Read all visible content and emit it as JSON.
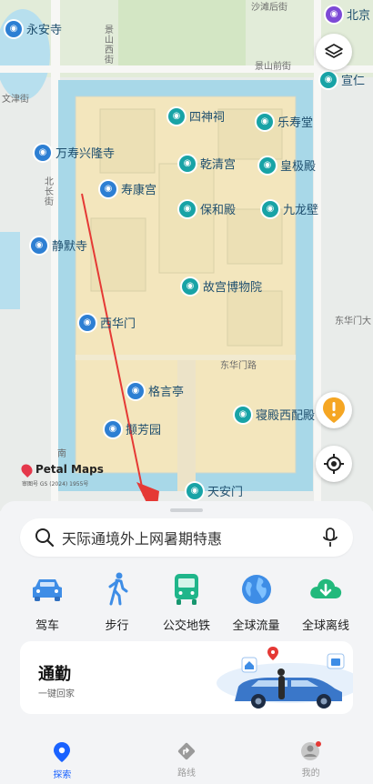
{
  "map": {
    "pois": [
      {
        "id": "yongansi",
        "label": "永安寺",
        "kind": "blue"
      },
      {
        "id": "beijing",
        "label": "北京"
      },
      {
        "id": "xuanren",
        "label": "宣仁"
      },
      {
        "id": "sishenci",
        "label": "四神祠"
      },
      {
        "id": "leshoutang",
        "label": "乐寿堂"
      },
      {
        "id": "wanshou",
        "label": "万寿兴隆寺",
        "kind": "blue"
      },
      {
        "id": "qianqinggong",
        "label": "乾清宫"
      },
      {
        "id": "huangjidian",
        "label": "皇极殿"
      },
      {
        "id": "shoukanggong",
        "label": "寿康宫"
      },
      {
        "id": "baohedian",
        "label": "保和殿"
      },
      {
        "id": "jiulongbi",
        "label": "九龙壁"
      },
      {
        "id": "jingmosi",
        "label": "静默寺",
        "kind": "blue"
      },
      {
        "id": "gugong",
        "label": "故宫博物院"
      },
      {
        "id": "xihuamen",
        "label": "西华门"
      },
      {
        "id": "geyanting",
        "label": "格言亭"
      },
      {
        "id": "qinfangyuan",
        "label": "撷芳园"
      },
      {
        "id": "qindian",
        "label": "寝殿西配殿"
      },
      {
        "id": "tiananmen",
        "label": "天安门"
      }
    ],
    "streets": {
      "shadou": "沙滩后街",
      "jingshanxi": "景山西街",
      "jingshanqian": "景山前街",
      "wenjin": "文津街",
      "beichang": "北长街",
      "donghuamenda": "东华门大",
      "donghuamenlu": "东华门路",
      "nan": "南"
    },
    "logo": "Petal Maps",
    "cert": "审图号 GS (2024) 1955号"
  },
  "search": {
    "placeholder": "天际通境外上网暑期特惠"
  },
  "quick_actions": [
    {
      "label": "驾车",
      "icon": "car-icon"
    },
    {
      "label": "步行",
      "icon": "walk-icon"
    },
    {
      "label": "公交地铁",
      "icon": "bus-icon"
    },
    {
      "label": "全球流量",
      "icon": "globe-icon"
    },
    {
      "label": "全球离线",
      "icon": "cloud-download-icon"
    }
  ],
  "commute": {
    "title": "通勤",
    "subtitle": "一键回家"
  },
  "tabs": [
    {
      "label": "探索",
      "active": true
    },
    {
      "label": "路线",
      "active": false
    },
    {
      "label": "我的",
      "active": false
    }
  ],
  "colors": {
    "accent": "#1a62ff",
    "moat": "#a8d8e8",
    "palace": "#f3e6bd",
    "teal": "#18a3a6",
    "annotation": "#e53935"
  }
}
